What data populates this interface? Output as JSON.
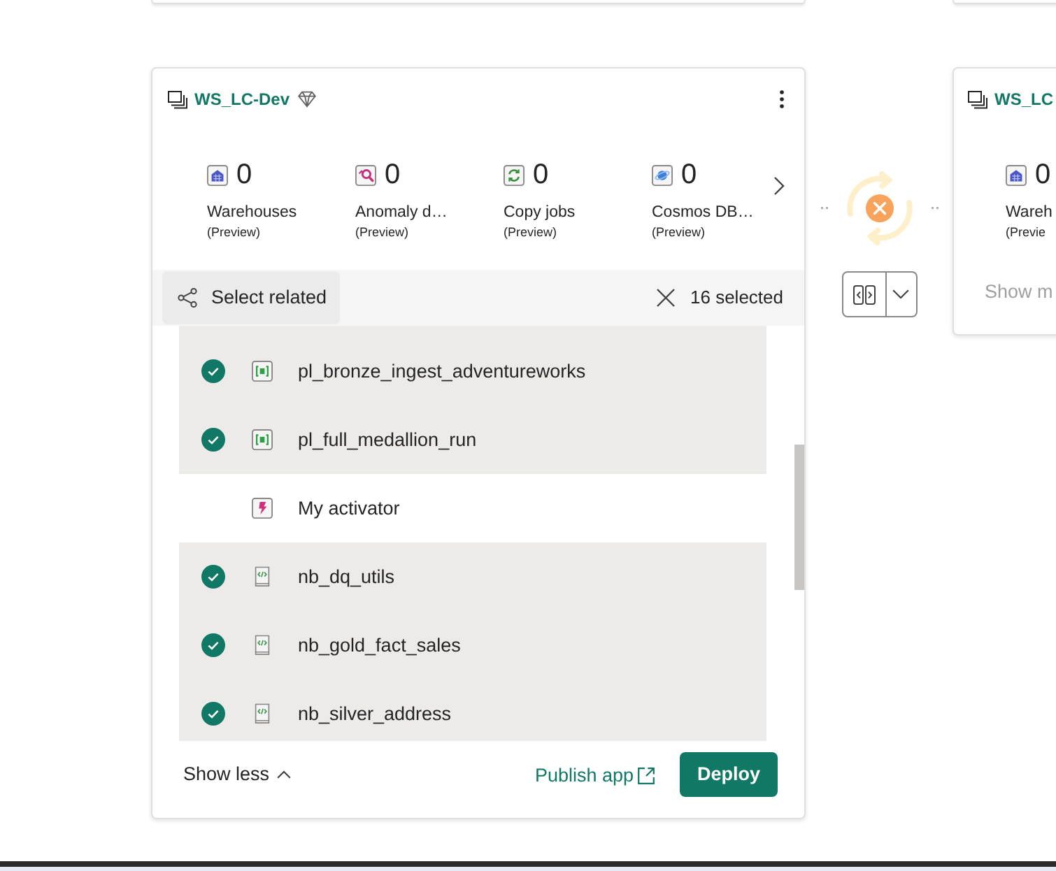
{
  "workspace_card": {
    "title": "WS_LC-Dev",
    "stats": [
      {
        "kind": "warehouse",
        "count": "0",
        "label": "Warehouses",
        "note": "(Preview)"
      },
      {
        "kind": "anomaly",
        "count": "0",
        "label": "Anomaly d…",
        "note": "(Preview)"
      },
      {
        "kind": "copy_job",
        "count": "0",
        "label": "Copy jobs",
        "note": "(Preview)"
      },
      {
        "kind": "cosmos_db",
        "count": "0",
        "label": "Cosmos DB…",
        "note": "(Preview)"
      }
    ],
    "toolbar": {
      "select_related": "Select related",
      "selected_count": "16 selected"
    },
    "items": [
      {
        "kind": "pipeline",
        "name": "pl_bronze_ingest_adventureworks",
        "selected": true
      },
      {
        "kind": "pipeline",
        "name": "pl_full_medallion_run",
        "selected": true
      },
      {
        "kind": "activator",
        "name": "My activator",
        "selected": false
      },
      {
        "kind": "notebook",
        "name": "nb_dq_utils",
        "selected": true
      },
      {
        "kind": "notebook",
        "name": "nb_gold_fact_sales",
        "selected": true
      },
      {
        "kind": "notebook",
        "name": "nb_silver_address",
        "selected": true
      }
    ],
    "footer": {
      "toggle": "Show less",
      "publish_link": "Publish app",
      "deploy_button": "Deploy"
    }
  },
  "deployment_status": {
    "failed": true
  },
  "target_card": {
    "title": "WS_LC",
    "stats": [
      {
        "kind": "warehouse",
        "count": "0",
        "label": "Wareh",
        "note": "(Previe"
      }
    ],
    "toggle": {
      "label": "Show m",
      "disabled": true
    }
  }
}
